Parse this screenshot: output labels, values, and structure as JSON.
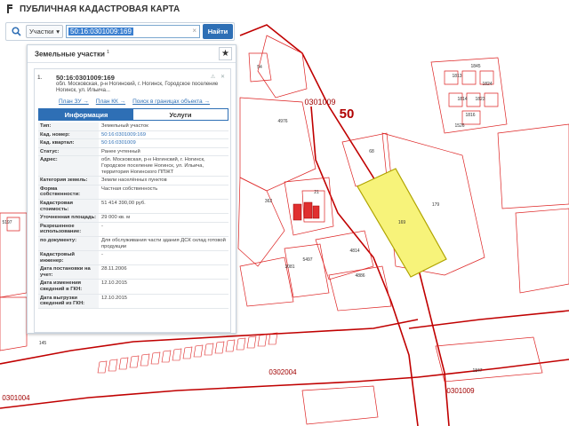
{
  "header": {
    "title": "ПУБЛИЧНАЯ КАДАСТРОВАЯ КАРТА"
  },
  "search": {
    "type_label": "Участки",
    "query": "50:16:0301009:169",
    "go_label": "Найти",
    "clear": "×"
  },
  "panel": {
    "title": "Земельные участки",
    "count": "1",
    "result": {
      "num": "1.",
      "cad_number": "50:16:0301009:169",
      "address": "обл. Московская, р-н Ногинский, г. Ногинск, Городское поселение Ногинск, ул. Ильича...",
      "links": [
        "План ЗУ →",
        "План КК →",
        "Поиск в границах объекта →"
      ],
      "tabs": [
        "Информация",
        "Услуги"
      ],
      "properties": [
        {
          "k": "Тип:",
          "v": "Земельный участок"
        },
        {
          "k": "Кад. номер:",
          "v": "50:16:0301009:169",
          "link": true
        },
        {
          "k": "Кад. квартал:",
          "v": "50:16:0301009",
          "link": true
        },
        {
          "k": "Статус:",
          "v": "Ранее учтенный"
        },
        {
          "k": "Адрес:",
          "v": "обл. Московская, р-н Ногинский, г. Ногинск, Городское поселение Ногинск, ул. Ильича, территория Ногинского ППЖТ"
        },
        {
          "k": "Категория земель:",
          "v": "Земли населённых пунктов"
        },
        {
          "k": "Форма собственности:",
          "v": "Частная собственность"
        },
        {
          "k": "Кадастровая стоимость:",
          "v": "51 414 390,00 руб."
        },
        {
          "k": "Уточненная площадь:",
          "v": "29 000 кв. м"
        },
        {
          "k": "Разрешенное использование:",
          "v": "-"
        },
        {
          "k": "по документу:",
          "v": "Для обслуживания части здания ДСК склад готовой продукции"
        },
        {
          "k": "Кадастровый инженер:",
          "v": "-"
        },
        {
          "k": "Дата постановки на учет:",
          "v": "28.11.2006"
        },
        {
          "k": "Дата изменения сведений в ГКН:",
          "v": "12.10.2015"
        },
        {
          "k": "Дата выгрузки сведений из ГКН:",
          "v": "12.10.2015"
        }
      ]
    }
  },
  "map": {
    "quarter_labels": [
      "0301009",
      "0302004",
      "0301004",
      "0301009"
    ],
    "district_label": "50",
    "parcel_labels": [
      "169",
      "179",
      "68",
      "4976",
      "21",
      "362",
      "4814",
      "5497",
      "3081",
      "4886",
      "1847",
      "189",
      "145",
      "54",
      "5197",
      "1845",
      "1813",
      "1814",
      "1823",
      "1824",
      "1816",
      "1526",
      "189"
    ],
    "colors": {
      "boundary": "#c00000",
      "selected_fill": "#f7f37a",
      "selected_stroke": "#b0a400",
      "building": "#e03030"
    }
  }
}
